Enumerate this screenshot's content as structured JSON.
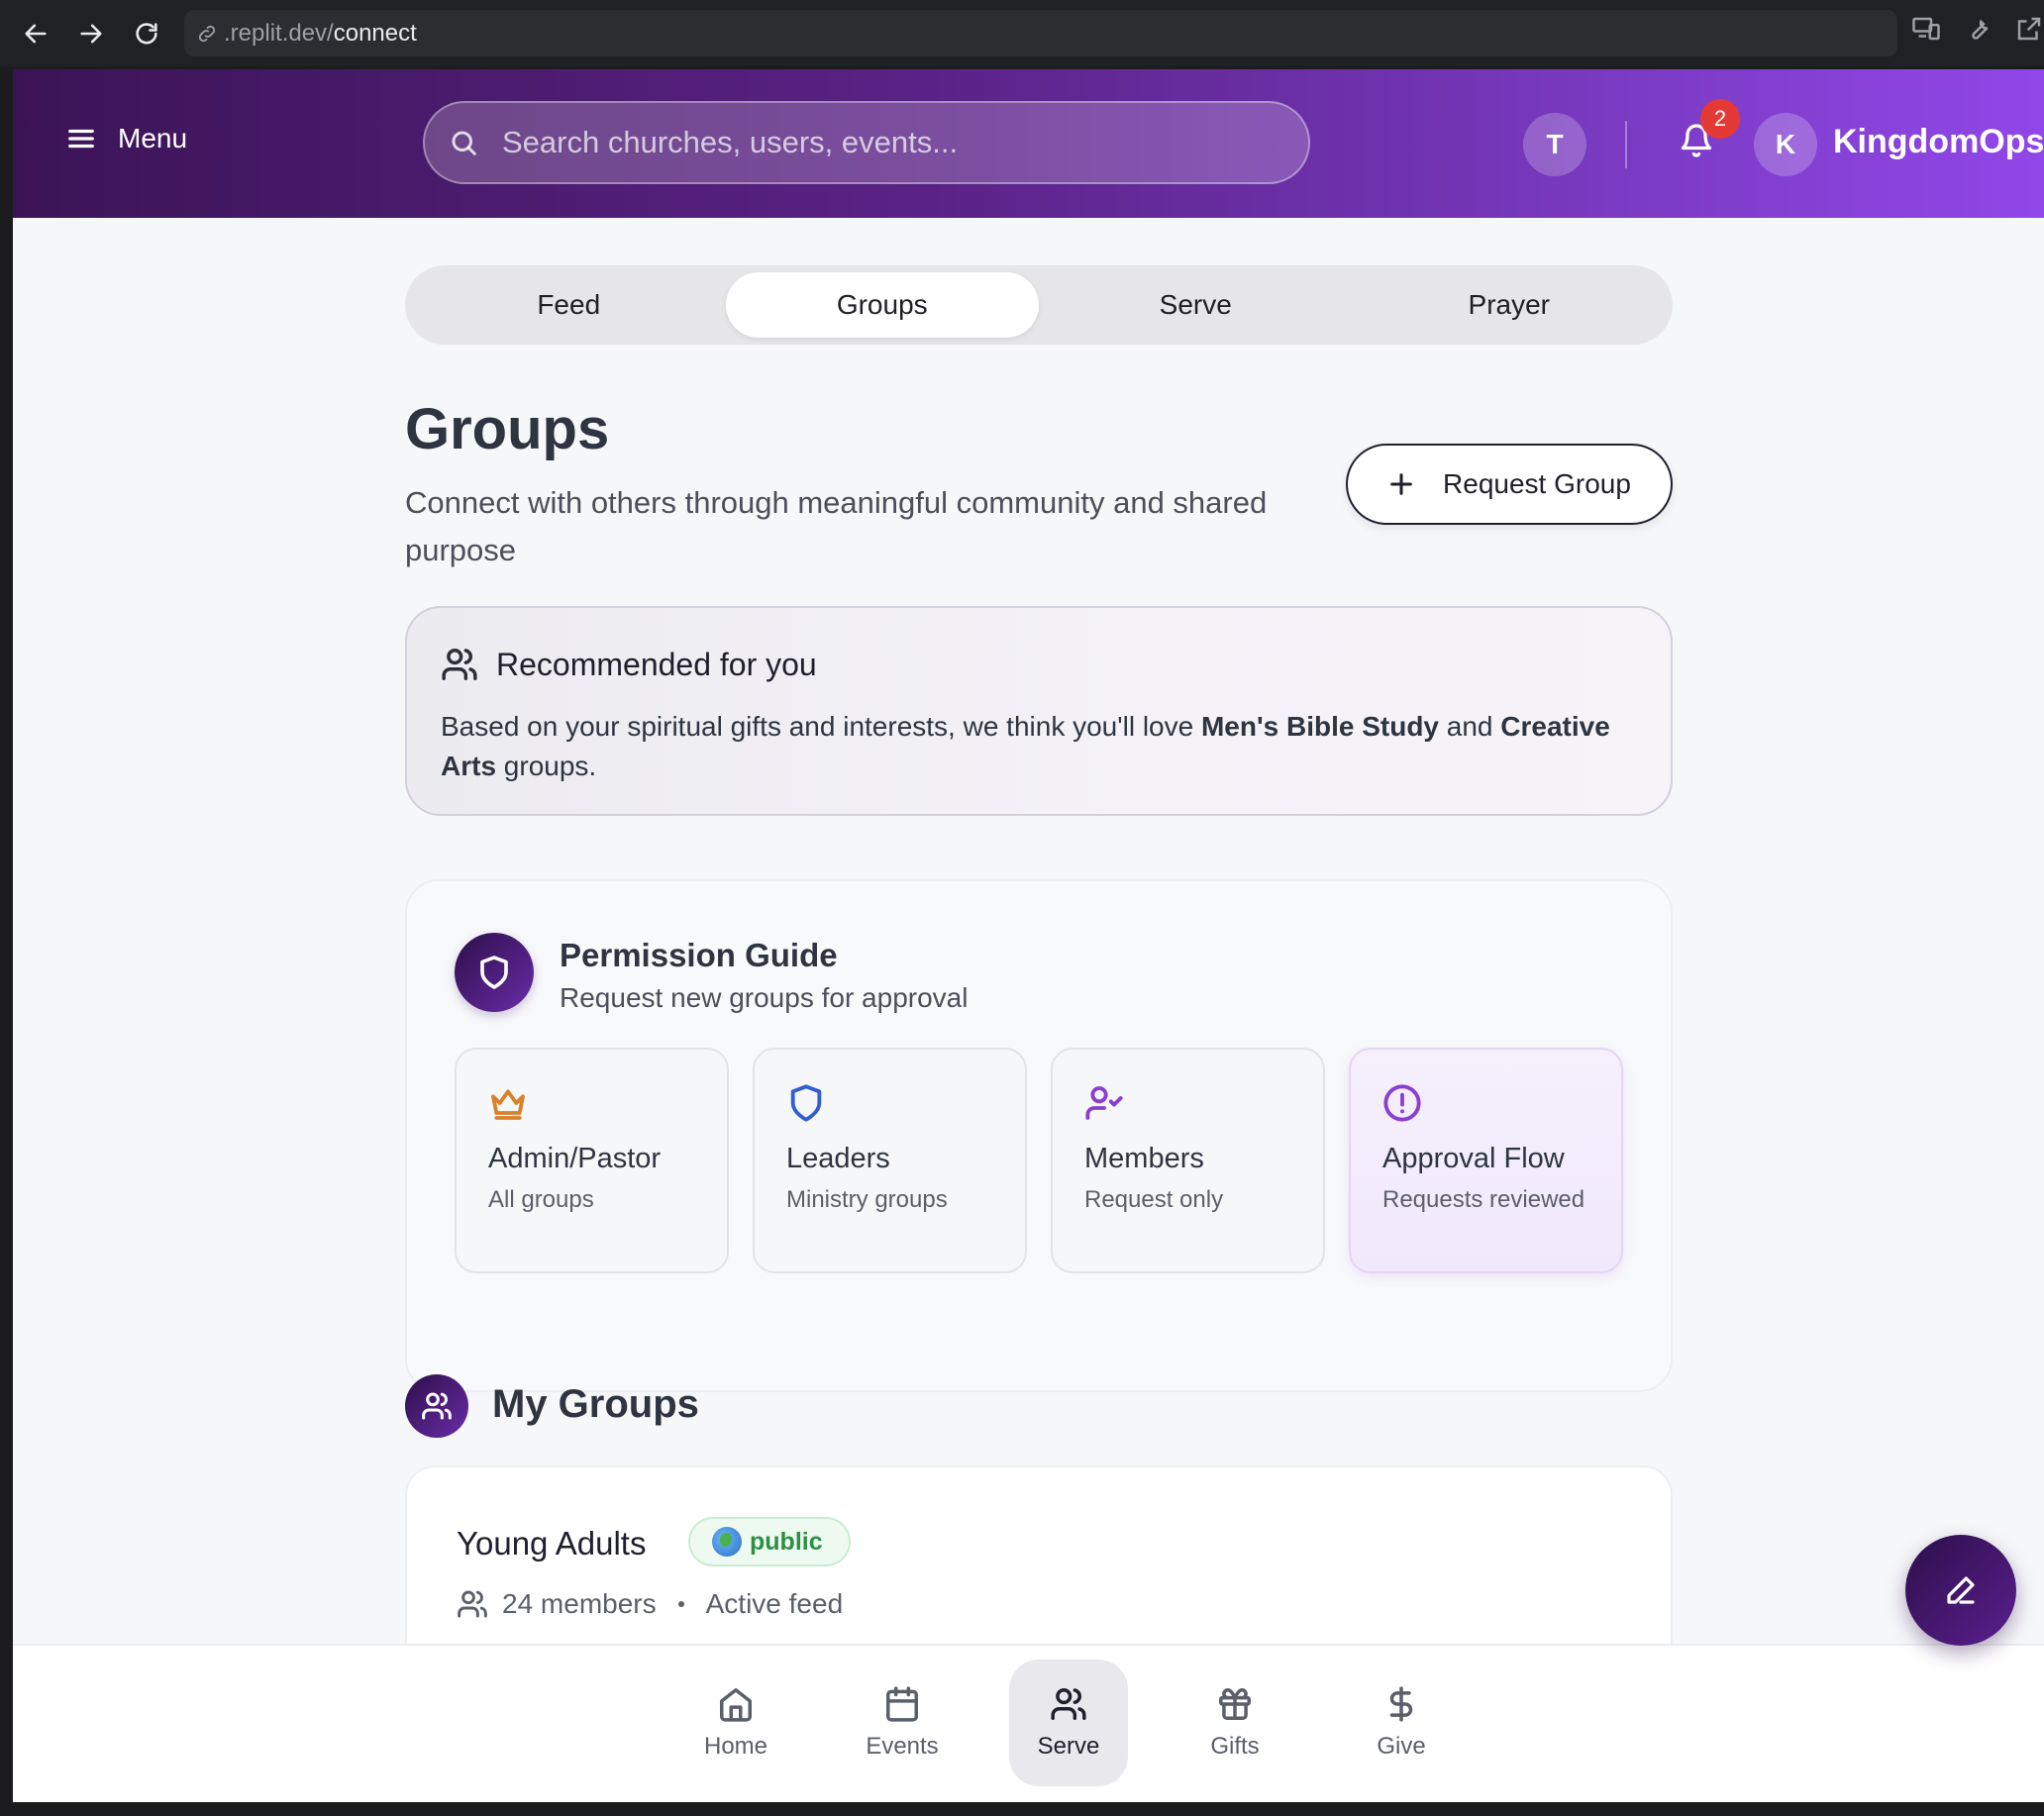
{
  "browser": {
    "url_prefix": ".replit.dev/",
    "url_path": "connect"
  },
  "header": {
    "menu_label": "Menu",
    "search_placeholder": "Search churches, users, events...",
    "user_initial": "T",
    "notification_count": "2",
    "brand_initial": "K",
    "brand_name": "KingdomOps"
  },
  "tabs": [
    {
      "label": "Feed",
      "active": false
    },
    {
      "label": "Groups",
      "active": true
    },
    {
      "label": "Serve",
      "active": false
    },
    {
      "label": "Prayer",
      "active": false
    }
  ],
  "page": {
    "title": "Groups",
    "subtitle": "Connect with others through meaningful community and shared purpose",
    "request_button": "Request Group"
  },
  "recommended": {
    "title": "Recommended for you",
    "text_before": "Based on your spiritual gifts and interests, we think you'll love ",
    "group1": "Men's Bible Study",
    "text_middle": " and ",
    "group2": "Creative Arts",
    "text_after": " groups."
  },
  "permission_guide": {
    "title": "Permission Guide",
    "subtitle": "Request new groups for approval",
    "cards": [
      {
        "title": "Admin/Pastor",
        "subtitle": "All groups",
        "icon": "crown-icon",
        "color": "#d9822b"
      },
      {
        "title": "Leaders",
        "subtitle": "Ministry groups",
        "icon": "shield-icon",
        "color": "#2f5fd0"
      },
      {
        "title": "Members",
        "subtitle": "Request only",
        "icon": "user-check-icon",
        "color": "#8a3fd1"
      },
      {
        "title": "Approval Flow",
        "subtitle": "Requests reviewed",
        "icon": "alert-circle-icon",
        "color": "#8a3fd1"
      }
    ]
  },
  "my_groups": {
    "title": "My Groups",
    "groups": [
      {
        "name": "Young Adults",
        "visibility": "public",
        "members": "24 members",
        "status": "Active feed"
      }
    ]
  },
  "bottom_nav": [
    {
      "label": "Home",
      "icon": "home-icon",
      "active": false
    },
    {
      "label": "Events",
      "icon": "calendar-icon",
      "active": false
    },
    {
      "label": "Serve",
      "icon": "users-icon",
      "active": true
    },
    {
      "label": "Gifts",
      "icon": "gift-icon",
      "active": false
    },
    {
      "label": "Give",
      "icon": "dollar-icon",
      "active": false
    }
  ],
  "colors": {
    "header_start": "#3b1456",
    "header_end": "#9147e8",
    "accent_dark": "#2d0f4a",
    "badge_red": "#e53935",
    "public_green": "#2f8f46"
  }
}
